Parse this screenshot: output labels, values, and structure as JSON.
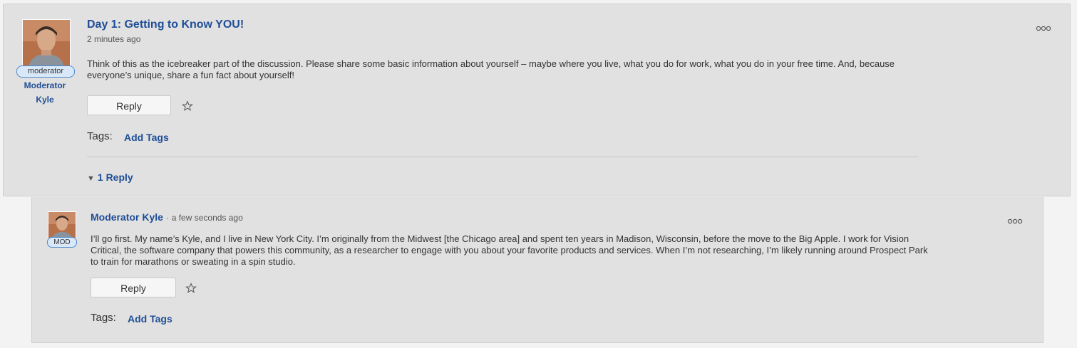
{
  "post": {
    "title": "Day 1: Getting to Know YOU!",
    "time": "2 minutes ago",
    "body": "Think of this as the icebreaker part of the discussion. Please share some basic information about yourself – maybe where you live, what you do for work, what you do in your free time. And, because everyone’s unique, share a fun fact about yourself!",
    "author_badge": "moderator",
    "author_name": "Moderator Kyle",
    "reply_label": "Reply",
    "tags_label": "Tags:",
    "add_tags_label": "Add Tags",
    "replies_count_label": "1 Reply",
    "more_icon": "more-options-icon",
    "favorite_icon": "star-icon"
  },
  "reply": {
    "author_name": "Moderator Kyle",
    "separator": "·",
    "time": "a few seconds ago",
    "author_badge": "MOD",
    "body": "I’ll go first. My name’s Kyle, and I live in New York City. I’m originally from the Midwest [the Chicago area] and spent ten years in Madison, Wisconsin, before the move to the Big Apple. I work for Vision Critical, the software company that powers this community, as a researcher to engage with you about your favorite products and services. When I’m not researching, I’m likely running around Prospect Park to train for marathons or sweating in a spin studio.",
    "reply_label": "Reply",
    "tags_label": "Tags:",
    "add_tags_label": "Add Tags"
  },
  "colors": {
    "link": "#1f4e96",
    "panel": "#e1e1e1",
    "badge_border": "#4f8bd0",
    "badge_fill": "#d9e8f8"
  }
}
